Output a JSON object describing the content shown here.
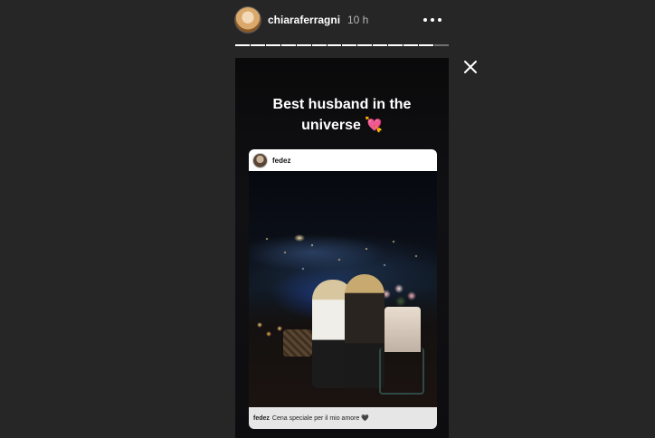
{
  "header": {
    "username": "chiaraferragni",
    "timestamp": "10 h",
    "more_icon": "more-horizontal-icon",
    "progress": {
      "segments": 14,
      "completed": 13
    }
  },
  "close_icon": "close-icon",
  "story": {
    "text_line1": "Best husband in the",
    "text_line2": "universe",
    "emoji": "💘",
    "shared_post": {
      "username": "fedez",
      "caption_user": "fedez",
      "caption_text": "Cena speciale per il mio amore 🖤"
    }
  },
  "colors": {
    "background": "#262626",
    "story_bg": "#0d0d10",
    "text": "#ffffff",
    "muted": "#b5b5b5"
  }
}
